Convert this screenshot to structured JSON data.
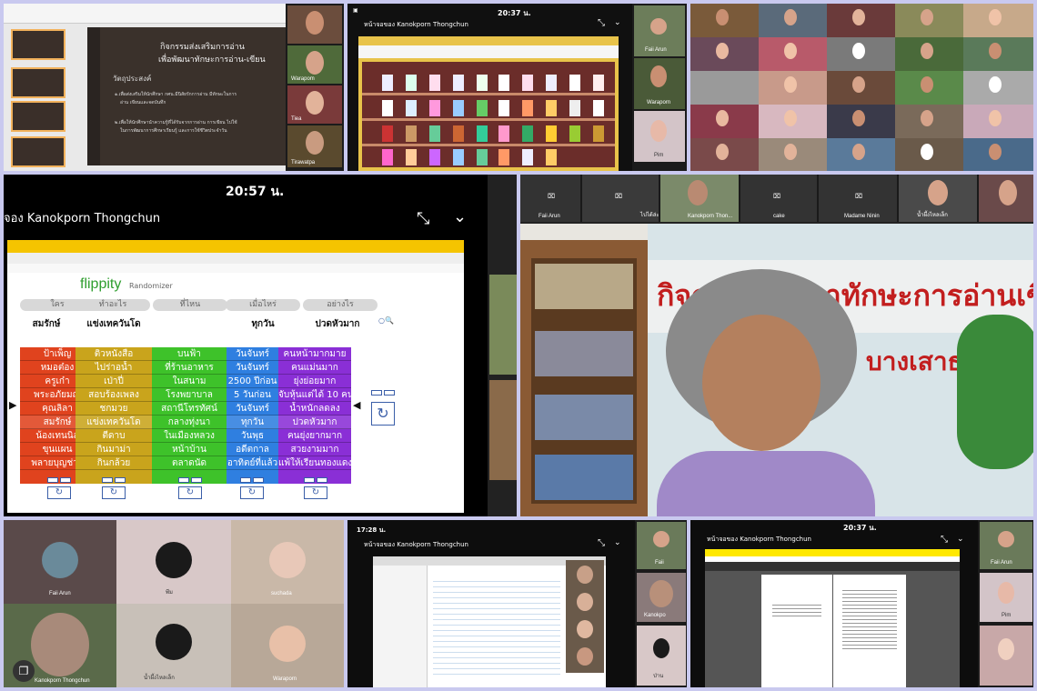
{
  "slide": {
    "title_line1": "กิจกรรมส่งเสริมการอ่าน",
    "title_line2": "เพื่อพัฒนาทักษะการอ่าน-เขียน",
    "objective_label": "วัตถุประสงค์",
    "bullet1_line1": "๑.เพื่อส่งเสริมให้นักศึกษา กศน.มีนิสัยรักการอ่าน มีทักษะในการ",
    "bullet1_line2": "อ่าน เขียนและจดบันทึก",
    "bullet2_line1": "๒.เพื่อให้นักศึกษานำความรู้ที่ได้รับจากการอ่าน การเขียน ไปใช้",
    "bullet2_line2": "ในการพัฒนาการศึกษาเรียนรู้ และการใช้ชีวิตประจำวัน",
    "participants": [
      "Warapom",
      "Tiea",
      "Tirawatpa"
    ]
  },
  "topmid": {
    "time": "20:37 น.",
    "meeting_owner": "หน้าจอของ Kanokporn Thongchun",
    "participants": [
      "Faii Arun",
      "Waraporn",
      "Pim"
    ]
  },
  "main": {
    "time": "20:57 น.",
    "meeting_owner": "จอง Kanokporn Thongchun",
    "brand": "flippity",
    "brand_sub": "Randomizer",
    "headers": [
      "ใคร",
      "ทำอะไร",
      "ที่ไหน",
      "เมื่อไหร่",
      "อย่างไร"
    ],
    "selected": [
      "สมรักษ์",
      "แข่งเทควันโด",
      "",
      "ทุกวัน",
      "ปวดหัวมาก"
    ],
    "columns": [
      {
        "color": "#e0431e",
        "items": [
          "ป้าเพ็ญ",
          "หมอต๋อง",
          "ครูเก๋า",
          "พระอภัยมณี",
          "คุณลิลา",
          "สมรักษ์",
          "น้องเทนนิส",
          "ขุนแผน",
          "พลายบุญช่วย"
        ]
      },
      {
        "color": "#c9a41c",
        "items": [
          "ติวหนังสือ",
          "ไปร่าอน้ำ",
          "เป่าปี่",
          "สอบร้องเพลง",
          "ชกมวย",
          "แข่งเทควันโด",
          "ตีดาบ",
          "กินมาม่า",
          "กินกล้วย"
        ]
      },
      {
        "color": "#3ec22a",
        "items": [
          "บนฟ้า",
          "ที่ร้านอาหาร",
          "ในสนาม",
          "โรงพยาบาล",
          "สถานีโทรทัศน์",
          "กลางทุ่งนา",
          "ในเมืองหลวง",
          "หน้าบ้าน",
          "ตลาดนัด"
        ]
      },
      {
        "color": "#2f7fe0",
        "items": [
          "วันจันทร์",
          "วันจันทร์",
          "2500 ปีก่อน",
          "5 วันก่อน",
          "วันจันทร์",
          "ทุกวัน",
          "วันพุธ",
          "อดีตกาล",
          "อาทิตย์ที่แล้ว"
        ]
      },
      {
        "color": "#8a2fd6",
        "items": [
          "คนหน้ามากมาย",
          "คนแม่นมาก",
          "ยุ่งย่อยมาก",
          "จับหุ้นแต่ได้ 10 คน",
          "น้ำหนักลดลง",
          "ปวดหัวมาก",
          "คนยุ่งยากมาก",
          "สวยงามมาก",
          "แพ้ให้เรียนทองแดง"
        ]
      }
    ]
  },
  "video": {
    "participants": [
      "Faii Arun",
      "ไปได้ล่ะ",
      "Kanokporn Thon...",
      "cake",
      "Madame Ninin",
      "น้ำผึ้งไหลเล็ก"
    ],
    "banner_text": "กิจกรรมพัฒนาทักษะการอ่านเขียน",
    "banner_sub": "บางเสาธง"
  },
  "bottomleft": {
    "participants": [
      "Faii Arun",
      "พีม",
      "suchada",
      "Kanokporn Thongchun",
      "น้ำผึ้งไหลเล็ก",
      "Waraporn"
    ]
  },
  "bottommid": {
    "time": "17:28 น.",
    "meeting_owner": "หน้าจอของ Kanokporn Thongchun",
    "participants": [
      "Faii",
      "Kanokpo",
      "ป่าน"
    ]
  },
  "bottomright": {
    "time": "20:37 น.",
    "meeting_owner": "หน้าจอของ Kanokporn Thongchun",
    "participants": [
      "Faii Arun",
      "Pim"
    ]
  }
}
